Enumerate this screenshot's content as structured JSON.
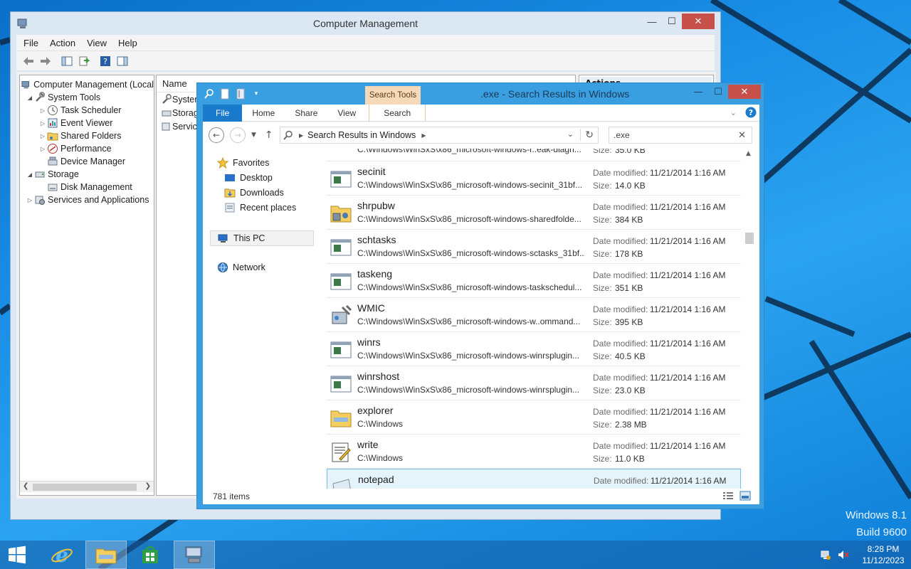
{
  "desktop": {
    "os_name": "Windows 8.1",
    "build": "Build 9600"
  },
  "cm_window": {
    "title": "Computer Management",
    "menu": [
      "File",
      "Action",
      "View",
      "Help"
    ],
    "tree": [
      {
        "label": "Computer Management (Local",
        "level": 0,
        "expander": ""
      },
      {
        "label": "System Tools",
        "level": 1,
        "expander": "◢"
      },
      {
        "label": "Task Scheduler",
        "level": 2,
        "expander": "▷"
      },
      {
        "label": "Event Viewer",
        "level": 2,
        "expander": "▷"
      },
      {
        "label": "Shared Folders",
        "level": 2,
        "expander": "▷"
      },
      {
        "label": "Performance",
        "level": 2,
        "expander": "▷"
      },
      {
        "label": "Device Manager",
        "level": 2,
        "expander": ""
      },
      {
        "label": "Storage",
        "level": 1,
        "expander": "◢"
      },
      {
        "label": "Disk Management",
        "level": 2,
        "expander": ""
      },
      {
        "label": "Services and Applications",
        "level": 1,
        "expander": "▷"
      }
    ],
    "list_header": "Name",
    "list_items": [
      "System",
      "Storag",
      "Service"
    ],
    "actions_header": "Actions"
  },
  "explorer": {
    "title": ".exe - Search Results in Windows",
    "context_tab": "Search Tools",
    "ribbon_tabs": [
      "File",
      "Home",
      "Share",
      "View",
      "Search"
    ],
    "address": "Search Results in Windows",
    "search_value": ".exe",
    "nav": {
      "favorites": "Favorites",
      "desktop": "Desktop",
      "downloads": "Downloads",
      "recent": "Recent places",
      "this_pc": "This PC",
      "network": "Network"
    },
    "labels": {
      "date_modified": "Date modified:",
      "size": "Size:"
    },
    "partial_top": {
      "path": "C:\\Windows\\WinSxS\\x86_microsoft-windows-r..eak-diagn...",
      "size": "35.0 KB"
    },
    "files": [
      {
        "name": "secinit",
        "path": "C:\\Windows\\WinSxS\\x86_microsoft-windows-secinit_31bf...",
        "date": "11/21/2014 1:16 AM",
        "size": "14.0 KB",
        "icon": "app-window-icon"
      },
      {
        "name": "shrpubw",
        "path": "C:\\Windows\\WinSxS\\x86_microsoft-windows-sharedfolde...",
        "date": "11/21/2014 1:16 AM",
        "size": "384 KB",
        "icon": "shared-folder-icon"
      },
      {
        "name": "schtasks",
        "path": "C:\\Windows\\WinSxS\\x86_microsoft-windows-sctasks_31bf...",
        "date": "11/21/2014 1:16 AM",
        "size": "178 KB",
        "icon": "app-window-icon"
      },
      {
        "name": "taskeng",
        "path": "C:\\Windows\\WinSxS\\x86_microsoft-windows-taskschedul...",
        "date": "11/21/2014 1:16 AM",
        "size": "351 KB",
        "icon": "app-window-icon"
      },
      {
        "name": "WMIC",
        "path": "C:\\Windows\\WinSxS\\x86_microsoft-windows-w..ommand...",
        "date": "11/21/2014 1:16 AM",
        "size": "395 KB",
        "icon": "wmic-icon"
      },
      {
        "name": "winrs",
        "path": "C:\\Windows\\WinSxS\\x86_microsoft-windows-winrsplugin...",
        "date": "11/21/2014 1:16 AM",
        "size": "40.5 KB",
        "icon": "app-window-icon"
      },
      {
        "name": "winrshost",
        "path": "C:\\Windows\\WinSxS\\x86_microsoft-windows-winrsplugin...",
        "date": "11/21/2014 1:16 AM",
        "size": "23.0 KB",
        "icon": "app-window-icon"
      },
      {
        "name": "explorer",
        "path": "C:\\Windows",
        "date": "11/21/2014 1:16 AM",
        "size": "2.38 MB",
        "icon": "explorer-folder-icon"
      },
      {
        "name": "write",
        "path": "C:\\Windows",
        "date": "11/21/2014 1:16 AM",
        "size": "11.0 KB",
        "icon": "wordpad-icon"
      },
      {
        "name": "notepad",
        "path": "",
        "date": "11/21/2014 1:16 AM",
        "size": "",
        "icon": "notepad-icon"
      }
    ],
    "status": "781 items"
  },
  "taskbar": {
    "time": "8:28 PM",
    "date": "11/12/2023"
  },
  "colors": {
    "accent": "#1979ca",
    "explorer_frame": "#3a9fe0",
    "close_red": "#c7504b",
    "search_tools_tab": "#f5d9b8"
  }
}
